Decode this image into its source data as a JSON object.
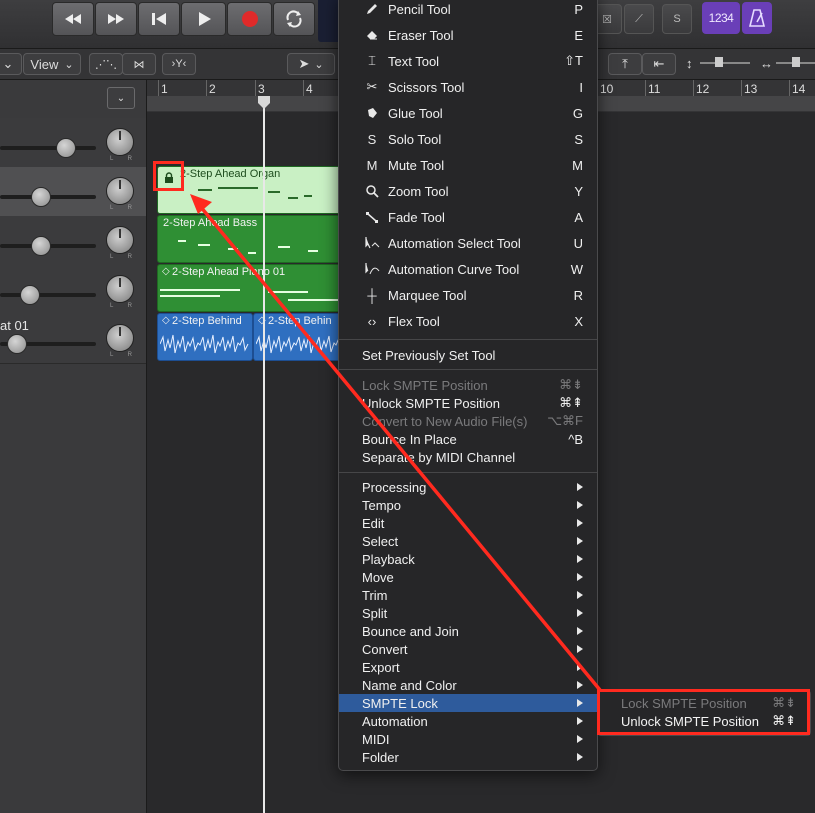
{
  "transport": {
    "buttons": [
      "rewind-icon",
      "fast-forward-icon",
      "go-to-start-icon",
      "play-icon",
      "record-icon",
      "cycle-icon"
    ],
    "count_in": "1234",
    "solo_label": "S"
  },
  "toolbar2": {
    "view_label": "View"
  },
  "ruler": {
    "bars": [
      "1",
      "2",
      "3",
      "4",
      "10",
      "11",
      "12",
      "13",
      "14"
    ]
  },
  "tracks": [
    {
      "name": ""
    },
    {
      "name": ""
    },
    {
      "name": ""
    },
    {
      "name": ""
    },
    {
      "name": "at 01"
    }
  ],
  "regions": [
    {
      "name": "2-Step Ahead Organ"
    },
    {
      "name": "2-Step Ahead Bass"
    },
    {
      "name": "2-Step Ahead Piano 01"
    },
    {
      "name": "2-Step Behind"
    },
    {
      "name": "2-Step Behin"
    }
  ],
  "menu": {
    "tools": [
      {
        "label": "Pencil Tool",
        "shortcut": "P",
        "icon": "pencil-icon"
      },
      {
        "label": "Eraser Tool",
        "shortcut": "E",
        "icon": "eraser-icon"
      },
      {
        "label": "Text Tool",
        "shortcut": "⇧T",
        "icon": "text-cursor-icon"
      },
      {
        "label": "Scissors Tool",
        "shortcut": "I",
        "icon": "scissors-icon"
      },
      {
        "label": "Glue Tool",
        "shortcut": "G",
        "icon": "glue-icon"
      },
      {
        "label": "Solo Tool",
        "shortcut": "S",
        "icon": "solo-icon"
      },
      {
        "label": "Mute Tool",
        "shortcut": "M",
        "icon": "mute-icon"
      },
      {
        "label": "Zoom Tool",
        "shortcut": "Y",
        "icon": "zoom-icon"
      },
      {
        "label": "Fade Tool",
        "shortcut": "A",
        "icon": "fade-icon"
      },
      {
        "label": "Automation Select Tool",
        "shortcut": "U",
        "icon": "automation-select-icon"
      },
      {
        "label": "Automation Curve Tool",
        "shortcut": "W",
        "icon": "automation-curve-icon"
      },
      {
        "label": "Marquee Tool",
        "shortcut": "R",
        "icon": "marquee-icon"
      },
      {
        "label": "Flex Tool",
        "shortcut": "X",
        "icon": "flex-icon"
      }
    ],
    "set_previous": "Set Previously Set Tool",
    "actions": [
      {
        "label": "Lock SMPTE Position",
        "shortcut": "⌘⇟",
        "enabled": false
      },
      {
        "label": "Unlock SMPTE Position",
        "shortcut": "⌘⇞",
        "enabled": true
      },
      {
        "label": "Convert to New Audio File(s)",
        "shortcut": "⌥⌘F",
        "enabled": false
      },
      {
        "label": "Bounce In Place",
        "shortcut": "^B",
        "enabled": true
      },
      {
        "label": "Separate by MIDI Channel",
        "shortcut": "",
        "enabled": true
      }
    ],
    "submenus": [
      "Processing",
      "Tempo",
      "Edit",
      "Select",
      "Playback",
      "Move",
      "Trim",
      "Split",
      "Bounce and Join",
      "Convert",
      "Export",
      "Name and Color",
      "SMPTE Lock",
      "Automation",
      "MIDI",
      "Folder"
    ],
    "highlighted": "SMPTE Lock"
  },
  "submenu": {
    "items": [
      {
        "label": "Lock SMPTE Position",
        "shortcut": "⌘⇟",
        "enabled": false
      },
      {
        "label": "Unlock SMPTE Position",
        "shortcut": "⌘⇞",
        "enabled": true
      }
    ]
  },
  "colors": {
    "annotation": "#ff2a1f",
    "menu_highlight": "#2e5b9c",
    "region_green": "#2f8f34",
    "region_blue": "#2f6fc0"
  }
}
